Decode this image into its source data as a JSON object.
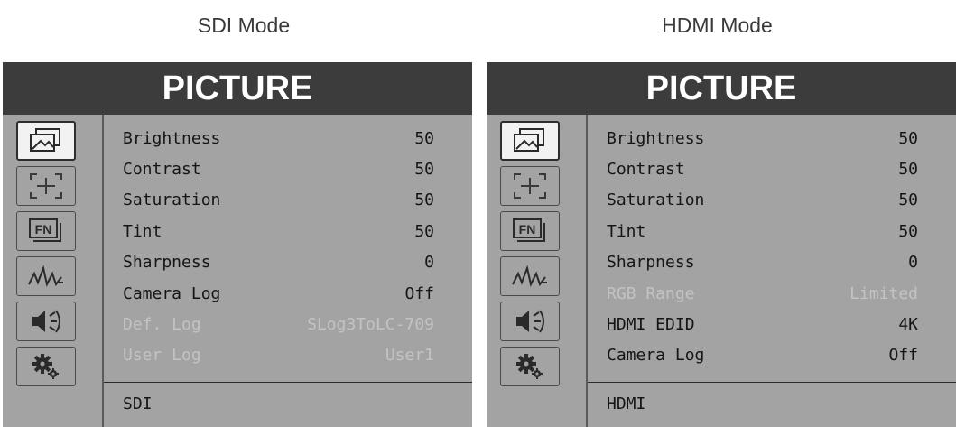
{
  "panels": [
    {
      "caption": "SDI Mode",
      "title": "PICTURE",
      "icons": [
        "picture-icon",
        "marker-icon",
        "fn-icon",
        "waveform-icon",
        "speaker-icon",
        "gear-icon"
      ],
      "selected_icon": 0,
      "items": [
        {
          "label": "Brightness",
          "value": "50",
          "disabled": false
        },
        {
          "label": "Contrast",
          "value": "50",
          "disabled": false
        },
        {
          "label": "Saturation",
          "value": "50",
          "disabled": false
        },
        {
          "label": "Tint",
          "value": "50",
          "disabled": false
        },
        {
          "label": "Sharpness",
          "value": "0",
          "disabled": false
        },
        {
          "label": "Camera Log",
          "value": "Off",
          "disabled": false
        },
        {
          "label": "Def. Log",
          "value": "SLog3ToLC-709",
          "disabled": true
        },
        {
          "label": "User Log",
          "value": "User1",
          "disabled": true
        }
      ],
      "footer": "SDI"
    },
    {
      "caption": "HDMI Mode",
      "title": "PICTURE",
      "icons": [
        "picture-icon",
        "marker-icon",
        "fn-icon",
        "waveform-icon",
        "speaker-icon",
        "gear-icon"
      ],
      "selected_icon": 0,
      "items": [
        {
          "label": "Brightness",
          "value": "50",
          "disabled": false
        },
        {
          "label": "Contrast",
          "value": "50",
          "disabled": false
        },
        {
          "label": "Saturation",
          "value": "50",
          "disabled": false
        },
        {
          "label": "Tint",
          "value": "50",
          "disabled": false
        },
        {
          "label": "Sharpness",
          "value": "0",
          "disabled": false
        },
        {
          "label": "RGB Range",
          "value": "Limited",
          "disabled": true
        },
        {
          "label": "HDMI EDID",
          "value": "4K",
          "disabled": false
        },
        {
          "label": "Camera Log",
          "value": "Off",
          "disabled": false
        }
      ],
      "footer": "HDMI"
    }
  ],
  "icon_labels": {
    "fn-icon": "FN"
  },
  "colors": {
    "panel_bg": "#a3a3a3",
    "title_bg": "#3c3c3c",
    "text": "#151515",
    "disabled_text": "#c3c3c3"
  }
}
